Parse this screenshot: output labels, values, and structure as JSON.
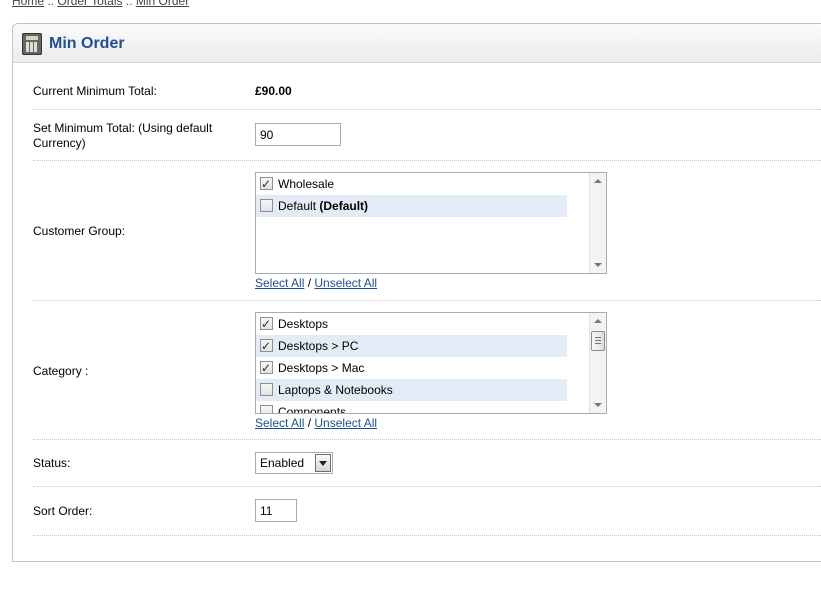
{
  "breadcrumb": {
    "home": "Home",
    "sep1": " :: ",
    "order_totals": "Order Totals",
    "sep2": " :: ",
    "current": "Min Order"
  },
  "heading": {
    "title": "Min Order",
    "icon": "calculator-icon"
  },
  "fields": {
    "current_min_label": "Current Minimum Total:",
    "current_min_value": "£90.00",
    "set_min_label": "Set Minimum Total: (Using default Currency)",
    "set_min_value": "90",
    "customer_group_label": "Customer Group:",
    "customer_groups": [
      {
        "label": "Wholesale",
        "suffix": "",
        "checked": true
      },
      {
        "label": "Default",
        "suffix": "(Default)",
        "checked": false
      }
    ],
    "select_all": "Select All",
    "slash": "/",
    "unselect_all": "Unselect All",
    "category_label": "Category :",
    "categories": [
      {
        "label": "Desktops",
        "checked": true
      },
      {
        "label": "Desktops > PC",
        "checked": true
      },
      {
        "label": "Desktops > Mac",
        "checked": true
      },
      {
        "label": "Laptops & Notebooks",
        "checked": false
      },
      {
        "label": "Components",
        "checked": false
      }
    ],
    "status_label": "Status:",
    "status_value": "Enabled",
    "sort_order_label": "Sort Order:",
    "sort_order_value": "11"
  }
}
